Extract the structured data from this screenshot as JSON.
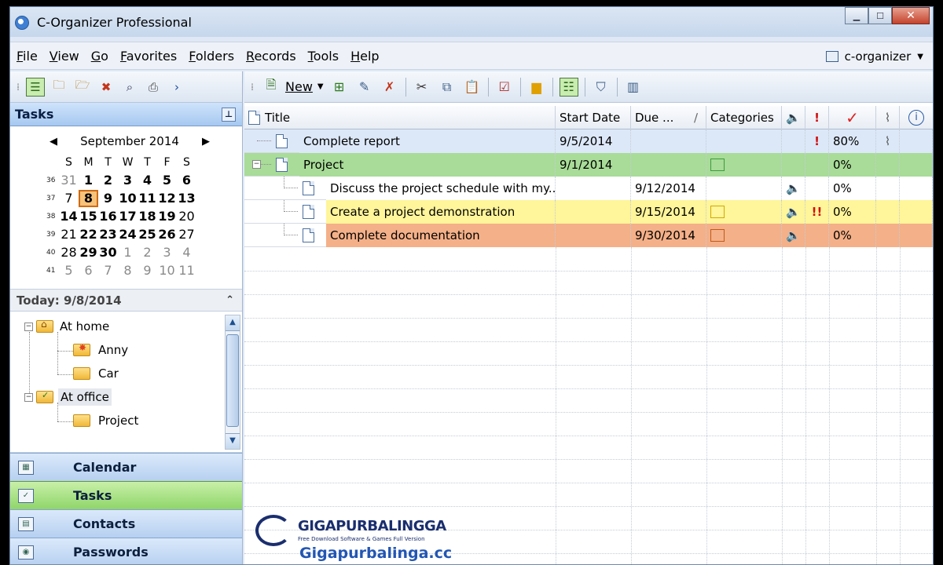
{
  "window": {
    "title": "C-Organizer Professional"
  },
  "menu": [
    "File",
    "View",
    "Go",
    "Favorites",
    "Folders",
    "Records",
    "Tools",
    "Help"
  ],
  "account": {
    "label": "c-organizer"
  },
  "left_panel": {
    "header": "Tasks",
    "calendar": {
      "month_label": "September 2014",
      "weekdays": [
        "S",
        "M",
        "T",
        "W",
        "T",
        "F",
        "S"
      ],
      "weeks": [
        {
          "num": "36",
          "days": [
            "31",
            "1",
            "2",
            "3",
            "4",
            "5",
            "6"
          ],
          "styles": [
            "g",
            "b",
            "b",
            "b",
            "b",
            "b",
            "b"
          ]
        },
        {
          "num": "37",
          "days": [
            "7",
            "8",
            "9",
            "10",
            "11",
            "12",
            "13"
          ],
          "styles": [
            "",
            "today",
            "b",
            "b",
            "b",
            "b",
            "b"
          ]
        },
        {
          "num": "38",
          "days": [
            "14",
            "15",
            "16",
            "17",
            "18",
            "19",
            "20"
          ],
          "styles": [
            "b",
            "b",
            "b",
            "b",
            "b",
            "b",
            ""
          ]
        },
        {
          "num": "39",
          "days": [
            "21",
            "22",
            "23",
            "24",
            "25",
            "26",
            "27"
          ],
          "styles": [
            "",
            "b",
            "b",
            "b",
            "b",
            "b",
            ""
          ]
        },
        {
          "num": "40",
          "days": [
            "28",
            "29",
            "30",
            "1",
            "2",
            "3",
            "4"
          ],
          "styles": [
            "",
            "b",
            "b",
            "g",
            "g",
            "g",
            "g"
          ]
        },
        {
          "num": "41",
          "days": [
            "5",
            "6",
            "7",
            "8",
            "9",
            "10",
            "11"
          ],
          "styles": [
            "g",
            "g",
            "g",
            "g",
            "g",
            "g",
            "g"
          ]
        }
      ]
    },
    "today_label": "Today: 9/8/2014",
    "folders": [
      {
        "label": "At home",
        "level": 0,
        "icon": "home-folder-icon"
      },
      {
        "label": "Anny",
        "level": 1,
        "icon": "star-folder-icon"
      },
      {
        "label": "Car",
        "level": 1,
        "icon": "folder-icon"
      },
      {
        "label": "At office",
        "level": 0,
        "icon": "office-folder-icon"
      },
      {
        "label": "Project",
        "level": 1,
        "icon": "folder-icon"
      }
    ],
    "nav": [
      "Calendar",
      "Tasks",
      "Contacts",
      "Passwords"
    ]
  },
  "toolbar": {
    "new_label": "New"
  },
  "grid": {
    "columns": [
      "Title",
      "Start Date",
      "Due ...",
      "Categories",
      "",
      "!",
      "",
      "",
      ""
    ],
    "rows": [
      {
        "title": "Complete report",
        "start": "9/5/2014",
        "due": "",
        "category": "",
        "sound": false,
        "priority": "!",
        "progress": "80%",
        "attach": true,
        "level": 0,
        "bg": "#dce8f8"
      },
      {
        "title": "Project",
        "start": "9/1/2014",
        "due": "",
        "category": "#3e9a3e",
        "sound": false,
        "priority": "",
        "progress": "0%",
        "attach": false,
        "level": 0,
        "bg": "#a8dc98"
      },
      {
        "title": "Discuss the project schedule with my...",
        "start": "",
        "due": "9/12/2014",
        "category": "",
        "sound": true,
        "priority": "",
        "progress": "0%",
        "attach": false,
        "level": 1,
        "bg": "#ffffff"
      },
      {
        "title": "Create a project demonstration",
        "start": "",
        "due": "9/15/2014",
        "category": "#d0a800",
        "sound": true,
        "priority": "!!",
        "progress": "0%",
        "attach": false,
        "level": 1,
        "bg": "#fff59a"
      },
      {
        "title": "Complete documentation",
        "start": "",
        "due": "9/30/2014",
        "category": "#c25a1a",
        "sound": true,
        "priority": "",
        "progress": "0%",
        "attach": false,
        "level": 1,
        "bg": "#f4b088"
      }
    ]
  },
  "watermark": {
    "brand": "GIGAPURBALINGGA",
    "tagline": "Free Download Software & Games Full Version",
    "url": "Gigapurbalinga.cc"
  }
}
